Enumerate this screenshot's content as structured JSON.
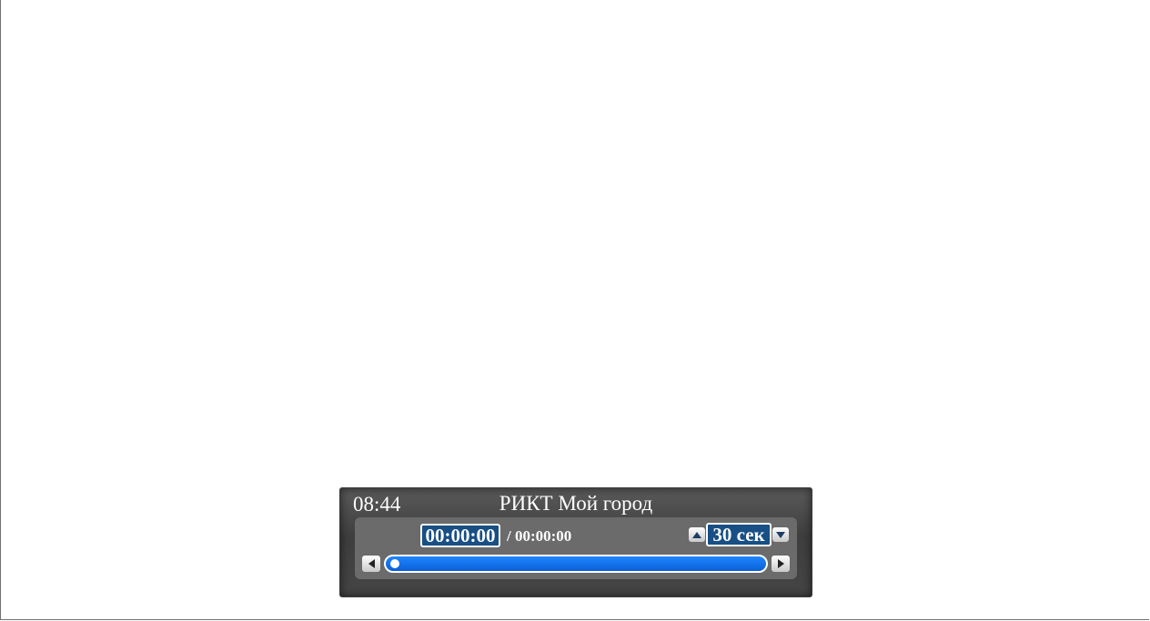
{
  "player": {
    "clock": "08:44",
    "channel_title": "РИКТ Мой город",
    "position_time": "00:00:00",
    "duration_time": "/ 00:00:00",
    "seek_step": "30 сек",
    "progress_fraction": 0,
    "icons": {
      "step_up": "triangle-up-icon",
      "step_down": "triangle-down-icon",
      "seek_back": "triangle-left-icon",
      "seek_forward": "triangle-right-icon"
    }
  },
  "colors": {
    "progress_track": "#0a6cf0",
    "field_background": "#184f84",
    "panel_background": "#6b6b6b"
  }
}
